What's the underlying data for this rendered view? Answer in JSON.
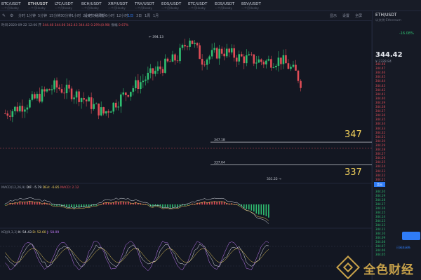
{
  "tabs": [
    {
      "symbol": "BTC/USDT",
      "sub": "一个月Hooby",
      "active": false
    },
    {
      "symbol": "ETH/USDT",
      "sub": "一个月Hooby",
      "active": true
    },
    {
      "symbol": "LTC/USDT",
      "sub": "一个月Hooby",
      "active": false
    },
    {
      "symbol": "BCH/USDT",
      "sub": "一个月Hooby",
      "active": false
    },
    {
      "symbol": "XRP/USDT",
      "sub": "一个月Hooby",
      "active": false
    },
    {
      "symbol": "TRX/USDT",
      "sub": "一个月Hooby",
      "active": false
    },
    {
      "symbol": "EOS/USDT",
      "sub": "一个月Hooby",
      "active": false
    },
    {
      "symbol": "ETC/USDT",
      "sub": "一个月Hooby",
      "active": false
    },
    {
      "symbol": "EOS/USDT",
      "sub": "一个月Hooby",
      "active": false
    },
    {
      "symbol": "BSV/USDT",
      "sub": "一个月Hooby",
      "active": false
    }
  ],
  "toolbar": {
    "items": [
      "分时",
      "1分钟",
      "5分钟",
      "15分钟",
      "30分钟",
      "1小时",
      "2小时",
      "4小时",
      "6小时",
      "12小时",
      "1日",
      "3日",
      "1周",
      "1月"
    ],
    "indicator_label": "设定交易周期",
    "right_items": [
      "显示",
      "设置",
      "全屏"
    ]
  },
  "info": {
    "date": "时间:2020-09-22 12:00",
    "open_label": "开",
    "open": "344.48",
    "high": "344.66",
    "low": "342.43",
    "close": "344.42",
    "change": "0.29%(0.98)",
    "amp_label": "振幅",
    "amp": "0.67%"
  },
  "macd": {
    "label": "MACD(12,26,9)",
    "dif": "DIF: -5.79",
    "dea": "DEA: -6.85",
    "macd": "MACD: 2.12"
  },
  "kdj": {
    "label": "KDJ(9,3,3)",
    "k": "K: 54.43",
    "d": "D: 52.60",
    "j": "J: 58.09"
  },
  "annotations": {
    "high": "394.13",
    "low": "331.22",
    "line_upper": "347.18",
    "line_lower": "337.04",
    "big_upper": "347",
    "big_lower": "337"
  },
  "price_axis": [
    "395.00",
    "390.00",
    "385.00",
    "380.00",
    "375.00",
    "370.00",
    "365.00",
    "360.00",
    "355.00",
    "350.00",
    "345.00",
    "340.00",
    "335.00",
    "330.00"
  ],
  "current_price_tag": "344.42",
  "macd_axis": [
    "5.00",
    "0.00",
    "-5.00",
    "-10.00"
  ],
  "kdj_axis": [
    "100.00",
    "50.00",
    "0.00"
  ],
  "right_panel": {
    "symbol": "ETH/USDT",
    "sub": "以太坊·Ethereum",
    "change": "-16.08%",
    "price": "344.42",
    "cny": "¥ 2328.84",
    "sell_tab": "卖出",
    "asks": [
      "344.48",
      "344.47",
      "344.46",
      "344.45",
      "344.44",
      "344.43",
      "344.42",
      "344.41",
      "344.40",
      "344.39",
      "344.38",
      "344.37",
      "344.36",
      "344.35",
      "344.34",
      "344.33",
      "344.32",
      "344.31",
      "344.30",
      "344.29",
      "344.28",
      "344.27",
      "344.26",
      "344.25",
      "344.24",
      "344.23",
      "344.22",
      "344.21"
    ],
    "bids": [
      "344.20",
      "344.19",
      "344.18",
      "344.17",
      "344.16",
      "344.15",
      "344.14",
      "344.13",
      "344.12",
      "344.11",
      "344.10",
      "344.09",
      "344.08",
      "344.07",
      "344.06",
      "344.05"
    ],
    "link": "已阅关闭系"
  },
  "watermark": "全色财经",
  "colors": {
    "up": "#2fbf71",
    "down": "#e14d57",
    "accent": "#2f7cf6",
    "annotation": "#f2d15c"
  }
}
